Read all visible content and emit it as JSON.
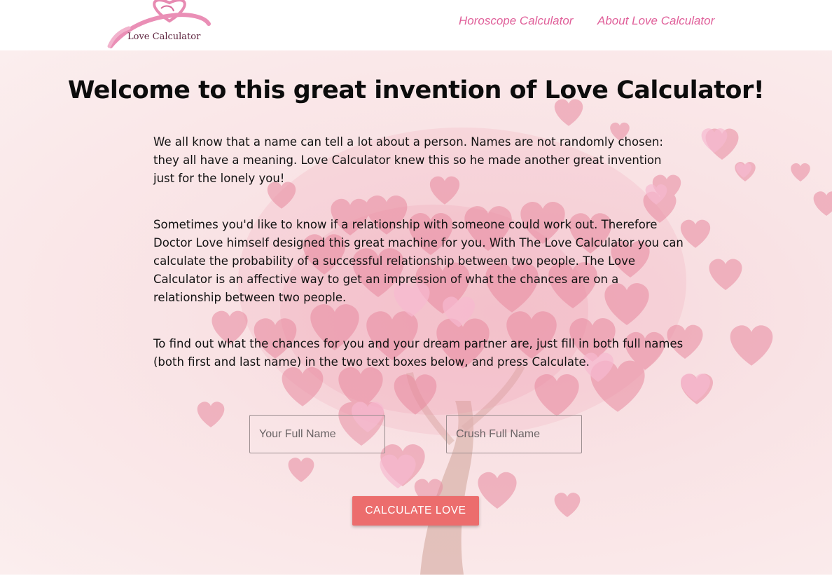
{
  "header": {
    "logo_text": "Love Calculator",
    "nav": [
      {
        "label": "Horoscope Calculator"
      },
      {
        "label": "About Love Calculator"
      }
    ]
  },
  "main": {
    "title": "Welcome to this great invention of Love Calculator!",
    "paragraphs": [
      "We all know that a name can tell a lot about a person. Names are not randomly chosen: they all have a meaning. Love Calculator knew this so he made another great invention just for the lonely you!",
      "Sometimes you'd like to know if a relationship with someone could work out. Therefore Doctor Love himself designed this great machine for you. With The Love Calculator you can calculate the probability of a successful relationship between two people. The Love Calculator is an affective way to get an impression of what the chances are on a relationship between two people.",
      "To find out what the chances for you and your dream partner are, just fill in both full names (both first and last name) in the two text boxes below, and press Calculate."
    ],
    "form": {
      "your_name": {
        "placeholder": "Your Full Name",
        "value": ""
      },
      "crush_name": {
        "placeholder": "Crush Full Name",
        "value": ""
      },
      "button_label": "CALCULATE LOVE"
    }
  },
  "colors": {
    "accent_pink": "#e0609a",
    "button": "#ec6d6d",
    "heart": "#e8899f"
  },
  "icons": [
    "ribbon-heart-logo-icon",
    "heart-tree-background"
  ]
}
